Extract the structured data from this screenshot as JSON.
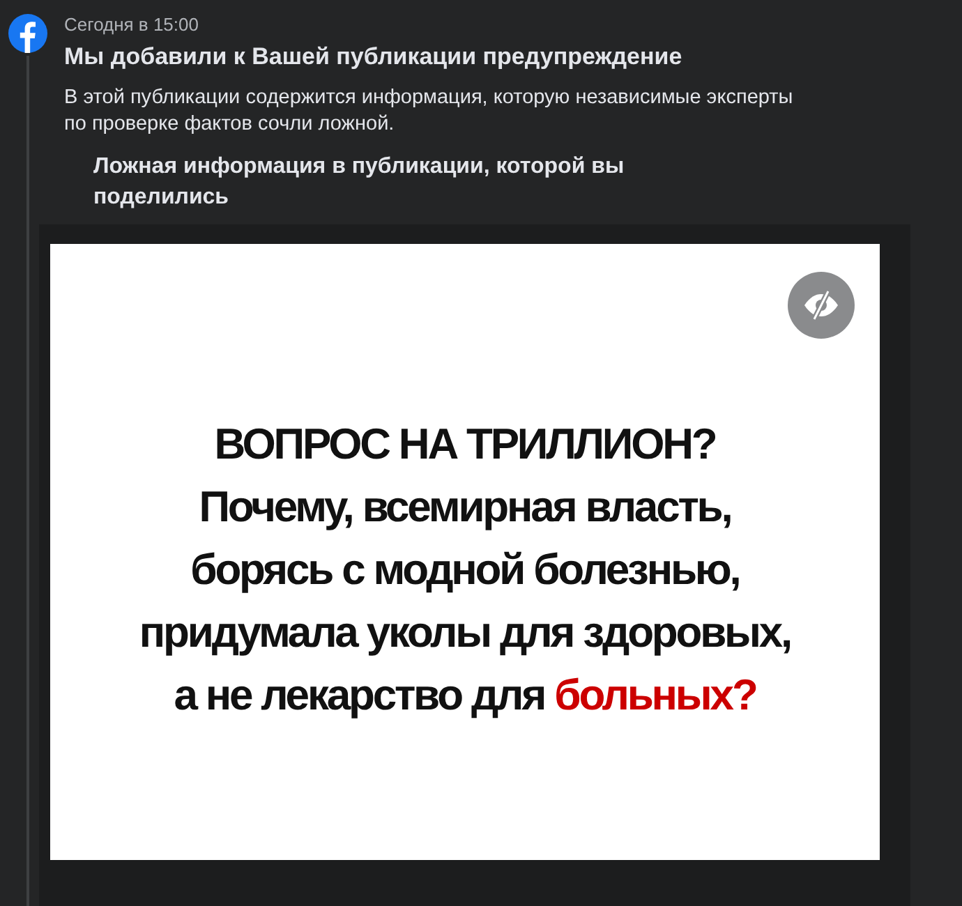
{
  "notification": {
    "time": "Сегодня в 15:00",
    "title": "Мы добавили к Вашей публикации предупреждение",
    "body": "В этой публикации содержится информация, которую независимые эксперты по проверке фактов сочли ложной."
  },
  "shared_post": {
    "heading": "Ложная информация в публикации, которой вы поделились",
    "image_text": [
      [
        {
          "text": "ВОПРОС НА ТРИЛЛИОН?",
          "highlight": false
        }
      ],
      [
        {
          "text": "Почему, всемирная власть,",
          "highlight": false
        }
      ],
      [
        {
          "text": "борясь с модной болезнью,",
          "highlight": false
        }
      ],
      [
        {
          "text": "придумала уколы для здоровых,",
          "highlight": false
        }
      ],
      [
        {
          "text": "а не лекарство для ",
          "highlight": false
        },
        {
          "text": "больных?",
          "highlight": true
        }
      ]
    ]
  }
}
